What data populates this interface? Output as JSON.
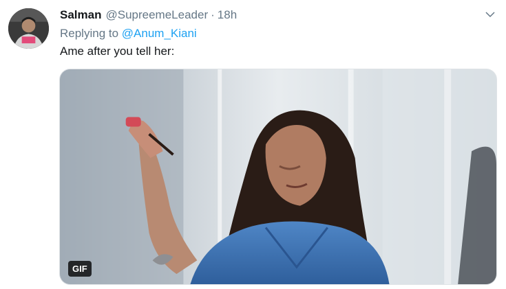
{
  "tweet": {
    "name": "Salman",
    "handle": "@SupreemeLeader",
    "separator": "·",
    "time": "18h",
    "replying_prefix": "Replying to ",
    "replying_to": "@Anum_Kiani",
    "text": "Ame after you tell her:",
    "media_badge": "GIF"
  },
  "icons": {
    "more": "chevron-down-icon"
  },
  "colors": {
    "link": "#1da1f2",
    "secondary_text": "#657786",
    "primary_text": "#14171a"
  }
}
